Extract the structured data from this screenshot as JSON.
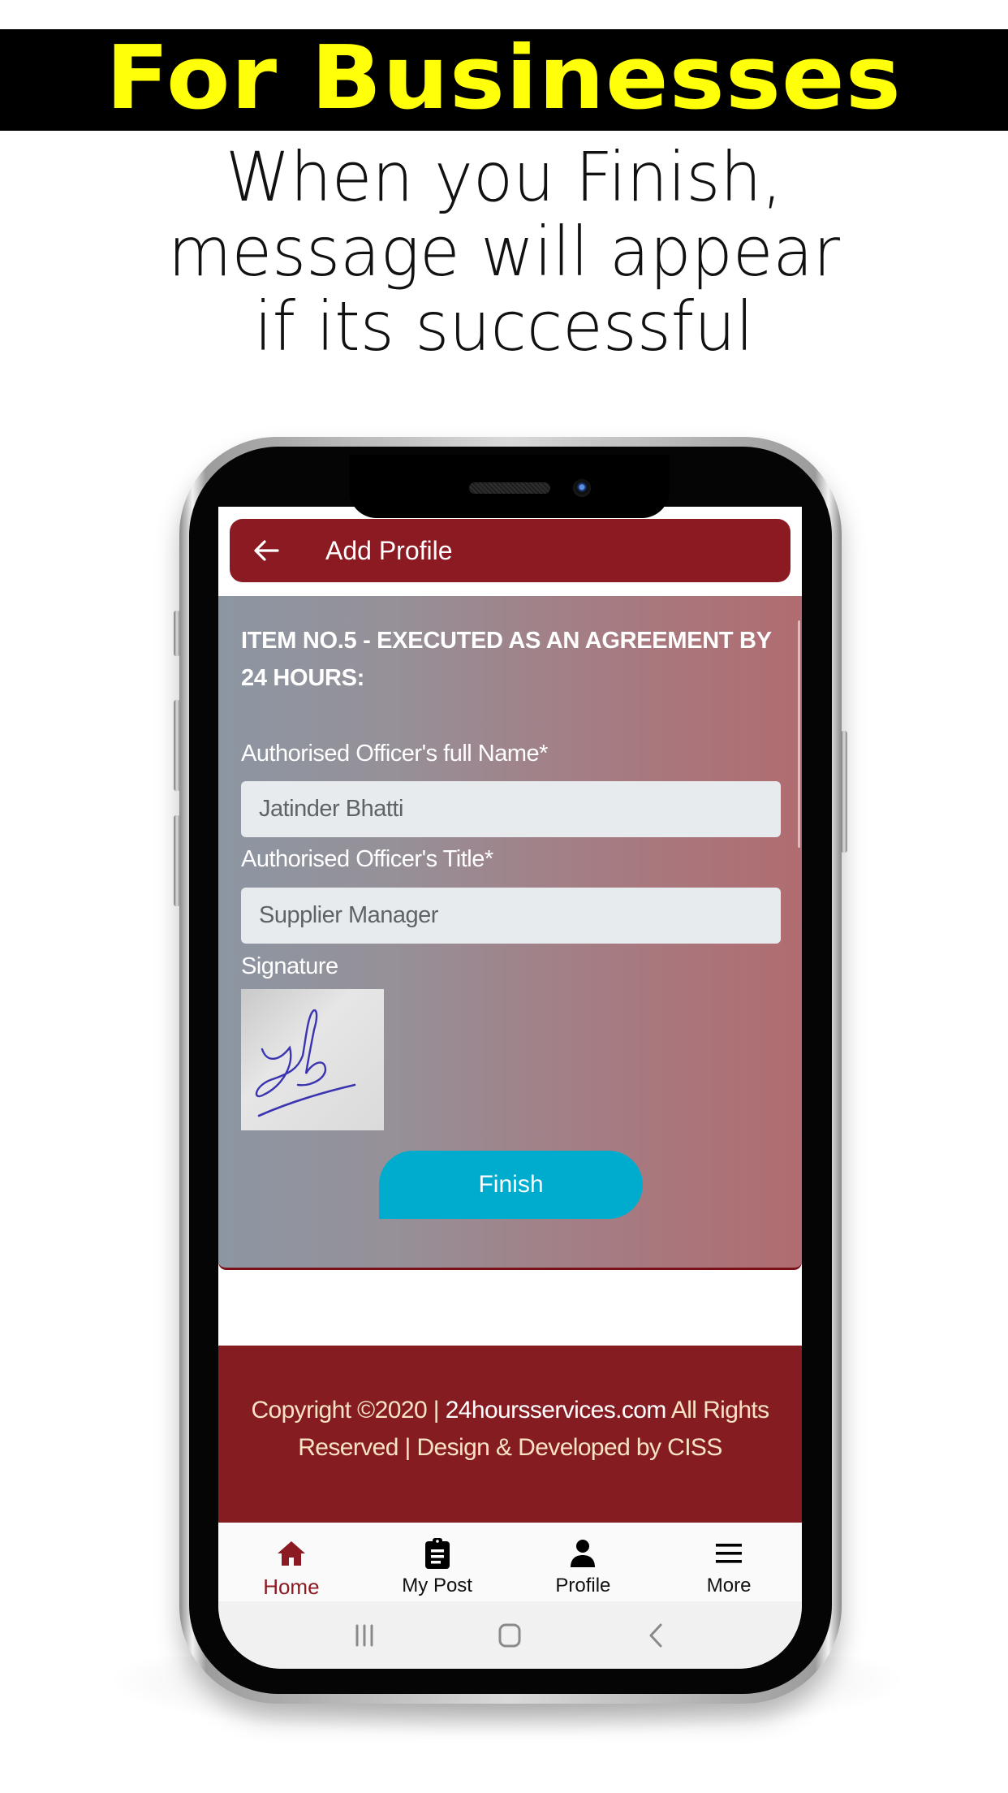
{
  "promo": {
    "banner_title": "For Businesses",
    "subtitle_lines": [
      "When you Finish,",
      "message will appear",
      "if its successful"
    ],
    "banner_text_color": "#ffff0a"
  },
  "app": {
    "header": {
      "title": "Add Profile",
      "back_icon": "arrow-left-icon"
    },
    "form": {
      "heading": "ITEM NO.5 - EXECUTED AS AN AGREEMENT BY 24 HOURS:",
      "fields": [
        {
          "label": "Authorised Officer's full Name*",
          "value": "Jatinder Bhatti"
        },
        {
          "label": "Authorised Officer's Title*",
          "value": "Supplier Manager"
        }
      ],
      "signature_label": "Signature",
      "finish_label": "Finish"
    },
    "footer": {
      "prefix": "Copyright ©2020 | ",
      "site": "24hoursservices.com",
      "suffix": " All Rights Reserved | Design & Developed by CISS"
    },
    "bottom_nav": [
      {
        "label": "Home",
        "icon": "home-icon",
        "active": true
      },
      {
        "label": "My Post",
        "icon": "clipboard-icon",
        "active": false
      },
      {
        "label": "Profile",
        "icon": "person-icon",
        "active": false
      },
      {
        "label": "More",
        "icon": "menu-icon",
        "active": false
      }
    ],
    "system_nav": [
      "recent-apps-icon",
      "home-circle-icon",
      "back-chevron-icon"
    ],
    "colors": {
      "brand": "#8c1a22",
      "footer": "#841c21",
      "accent_button": "#00acce"
    }
  }
}
